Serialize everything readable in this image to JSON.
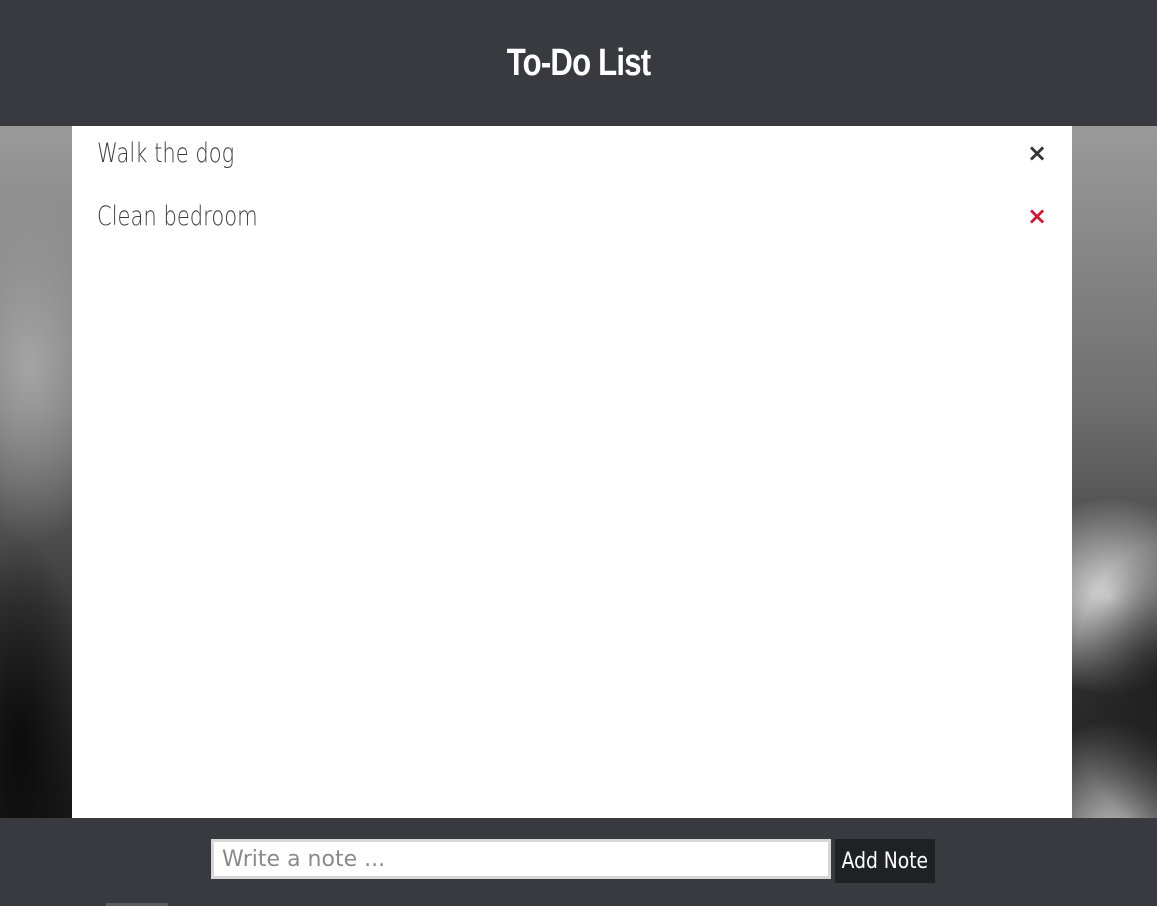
{
  "header": {
    "title": "To-Do List"
  },
  "notes": [
    {
      "text": "Walk the dog",
      "delete_icon": "close-icon",
      "icon_color": "#333333"
    },
    {
      "text": "Clean bedroom",
      "delete_icon": "close-icon",
      "icon_color": "#d0183a"
    }
  ],
  "footer": {
    "input_placeholder": "Write a note ...",
    "input_value": "",
    "add_button_label": "Add Note"
  },
  "colors": {
    "header_bg": "#393a40",
    "panel_bg": "#ffffff",
    "button_bg": "#202124",
    "accent_red": "#d0183a"
  }
}
